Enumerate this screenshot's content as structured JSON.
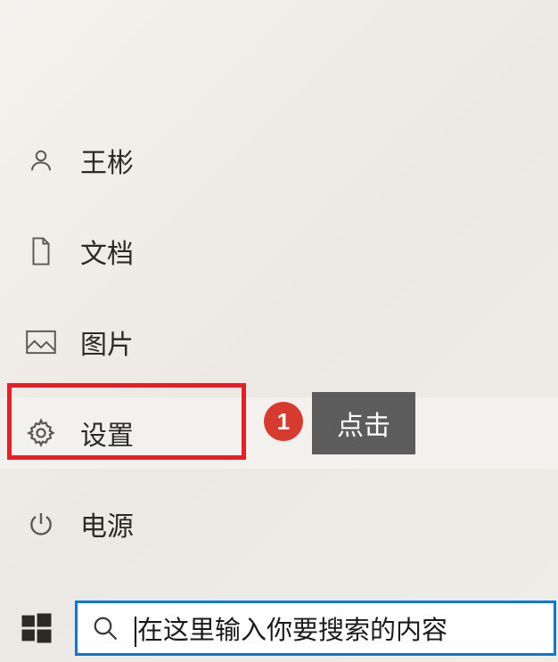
{
  "menu": {
    "items": [
      {
        "label": "王彬",
        "icon": "user-icon"
      },
      {
        "label": "文档",
        "icon": "document-icon"
      },
      {
        "label": "图片",
        "icon": "image-icon"
      },
      {
        "label": "设置",
        "icon": "gear-icon"
      },
      {
        "label": "电源",
        "icon": "power-icon"
      }
    ]
  },
  "annotation": {
    "badge": "1",
    "label": "点击"
  },
  "search": {
    "placeholder": "在这里输入你要搜索的内容"
  }
}
